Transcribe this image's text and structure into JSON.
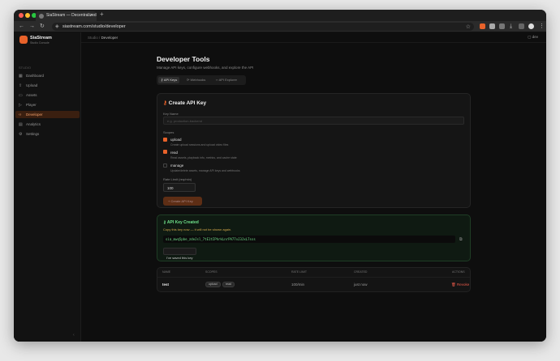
{
  "browser": {
    "tab_title": "SiaStream — Decentralized",
    "url": "siastream.com/studio/developer",
    "controls": {
      "back": "←",
      "forward": "→",
      "reload": "↻"
    }
  },
  "sidebar": {
    "brand": "SiaStream",
    "brand_sub": "Studio Console",
    "section": "STUDIO",
    "items": [
      {
        "label": "Dashboard",
        "icon": "grid-icon"
      },
      {
        "label": "Upload",
        "icon": "upload-icon"
      },
      {
        "label": "Assets",
        "icon": "folder-icon"
      },
      {
        "label": "Player",
        "icon": "play-icon"
      },
      {
        "label": "Developer",
        "icon": "code-icon",
        "active": true
      },
      {
        "label": "Analytics",
        "icon": "chart-icon"
      },
      {
        "label": "Settings",
        "icon": "gear-icon"
      }
    ]
  },
  "topbar": {
    "breadcrumb_root": "Studio",
    "breadcrumb_sep": "/",
    "breadcrumb_current": "Developer",
    "dev_label": "dev"
  },
  "page": {
    "title": "Developer Tools",
    "subtitle": "Manage API keys, configure webhooks, and explore the API",
    "tabs": [
      {
        "label": "API Keys",
        "active": true
      },
      {
        "label": "Webhooks"
      },
      {
        "label": "API Explorer"
      }
    ]
  },
  "create_card": {
    "title": "Create API Key",
    "key_name_label": "Key Name",
    "key_name_placeholder": "e.g. production-backend",
    "scopes_label": "Scopes",
    "scopes": [
      {
        "name": "upload",
        "desc": "Create upload sessions and upload video files",
        "checked": true
      },
      {
        "name": "read",
        "desc": "Read assets, playback info, metrics, and cache state",
        "checked": true
      },
      {
        "name": "manage",
        "desc": "Update/delete assets, manage API keys and webhooks",
        "checked": false
      }
    ],
    "rate_limit_label": "Rate Limit (req/min)",
    "rate_limit_value": "100",
    "create_button": "+ Create API Key"
  },
  "created_card": {
    "title": "API Key Created",
    "warning": "Copy this key now — it will not be shown again.",
    "key": "sia_mwq5pbe_zdeJsl_7tE1tIPhrkLnrPA77vJ3JxL7sss",
    "saved_button": "I've saved this key"
  },
  "table": {
    "headers": [
      "NAME",
      "SCOPES",
      "RATE LIMIT",
      "CREATED",
      "ACTIONS"
    ],
    "rows": [
      {
        "name": "test",
        "scopes": [
          "upload",
          "read"
        ],
        "rate_limit": "100/min",
        "created": "just now",
        "action": "Revoke"
      }
    ]
  }
}
